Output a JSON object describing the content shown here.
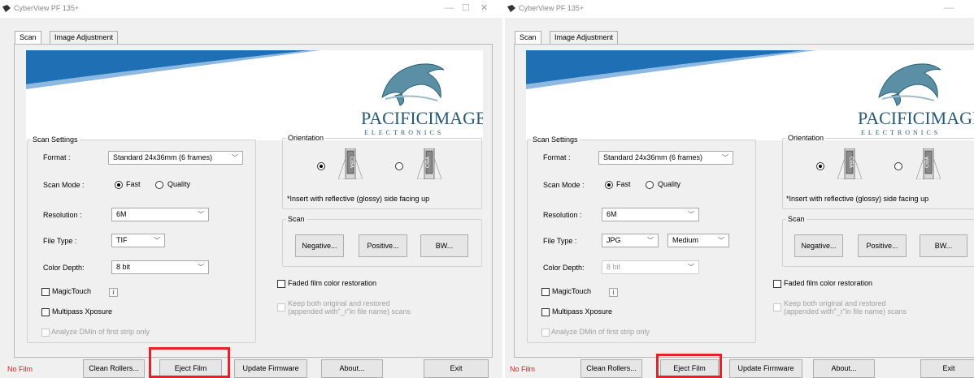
{
  "windows": [
    {
      "id": "left",
      "title": "CyberView PF 135+",
      "tabs": [
        "Scan",
        "Image Adjustment"
      ],
      "banner": {
        "brand": "PACIFICIMAGE",
        "brand_sub": "ELECTRONICS"
      },
      "scan_settings": {
        "legend": "Scan Settings",
        "format_label": "Format :",
        "format_value": "Standard 24x36mm (6 frames)",
        "scan_mode_label": "Scan Mode :",
        "scan_mode_options": [
          "Fast",
          "Quality"
        ],
        "scan_mode_selected": "Fast",
        "resolution_label": "Resolution :",
        "resolution_value": "6M",
        "file_type_label": "File Type :",
        "file_type_value": "TIF",
        "color_depth_label": "Color Depth:",
        "color_depth_value": "8 bit",
        "magic_touch_label": "MagicTouch",
        "info_glyph": "i",
        "multipass_label": "Multipass Xposure",
        "analyze_label": "Analyze DMin of first strip only"
      },
      "orientation": {
        "legend": "Orientation",
        "note": "*Insert with reflective (glossy) side facing up",
        "selected": "left",
        "film_label": "CIBA"
      },
      "scan": {
        "legend": "Scan",
        "buttons": [
          "Negative...",
          "Positive...",
          "BW..."
        ]
      },
      "faded_label": "Faded film color restoration",
      "keep_label_1": "Keep both original and restored",
      "keep_label_2": "(appended with\"_r\"in file name) scans",
      "footer": {
        "status": "No Film",
        "buttons": [
          "Clean Rollers...",
          "Eject Film",
          "Update Firmware",
          "About...",
          "Exit"
        ]
      }
    },
    {
      "id": "right",
      "title": "CyberView PF 135+",
      "tabs": [
        "Scan",
        "Image Adjustment"
      ],
      "banner": {
        "brand": "PACIFICIMAGE",
        "brand_sub": "ELECTRONICS"
      },
      "scan_settings": {
        "legend": "Scan Settings",
        "format_label": "Format :",
        "format_value": "Standard 24x36mm (6 frames)",
        "scan_mode_label": "Scan Mode :",
        "scan_mode_options": [
          "Fast",
          "Quality"
        ],
        "scan_mode_selected": "Fast",
        "resolution_label": "Resolution :",
        "resolution_value": "6M",
        "file_type_label": "File Type :",
        "file_type_value": "JPG",
        "quality_value": "Medium",
        "color_depth_label": "Color Depth:",
        "color_depth_value": "8 bit",
        "magic_touch_label": "MagicTouch",
        "info_glyph": "i",
        "multipass_label": "Multipass Xposure",
        "analyze_label": "Analyze DMin of first strip only"
      },
      "orientation": {
        "legend": "Orientation",
        "note": "*Insert with reflective (glossy) side facing up",
        "selected": "left",
        "film_label": "CIBA"
      },
      "scan": {
        "legend": "Scan",
        "buttons": [
          "Negative...",
          "Positive...",
          "BW..."
        ]
      },
      "faded_label": "Faded film color restoration",
      "keep_label_1": "Keep both original and restored",
      "keep_label_2": "(appended with\"_r\"in file name) scans",
      "footer": {
        "status": "No Film",
        "buttons": [
          "Clean Rollers...",
          "Eject Film",
          "Update Firmware",
          "About...",
          "Exit"
        ]
      }
    }
  ],
  "colors": {
    "highlight": "#e8202a",
    "no_film": "#e02020",
    "banner_blue": "#1f6fb5",
    "brand": "#2a5a7a"
  },
  "icons": [
    "app-icon",
    "minimize-icon",
    "maximize-icon",
    "close-icon",
    "dolphin-logo",
    "film-strip-icon"
  ]
}
